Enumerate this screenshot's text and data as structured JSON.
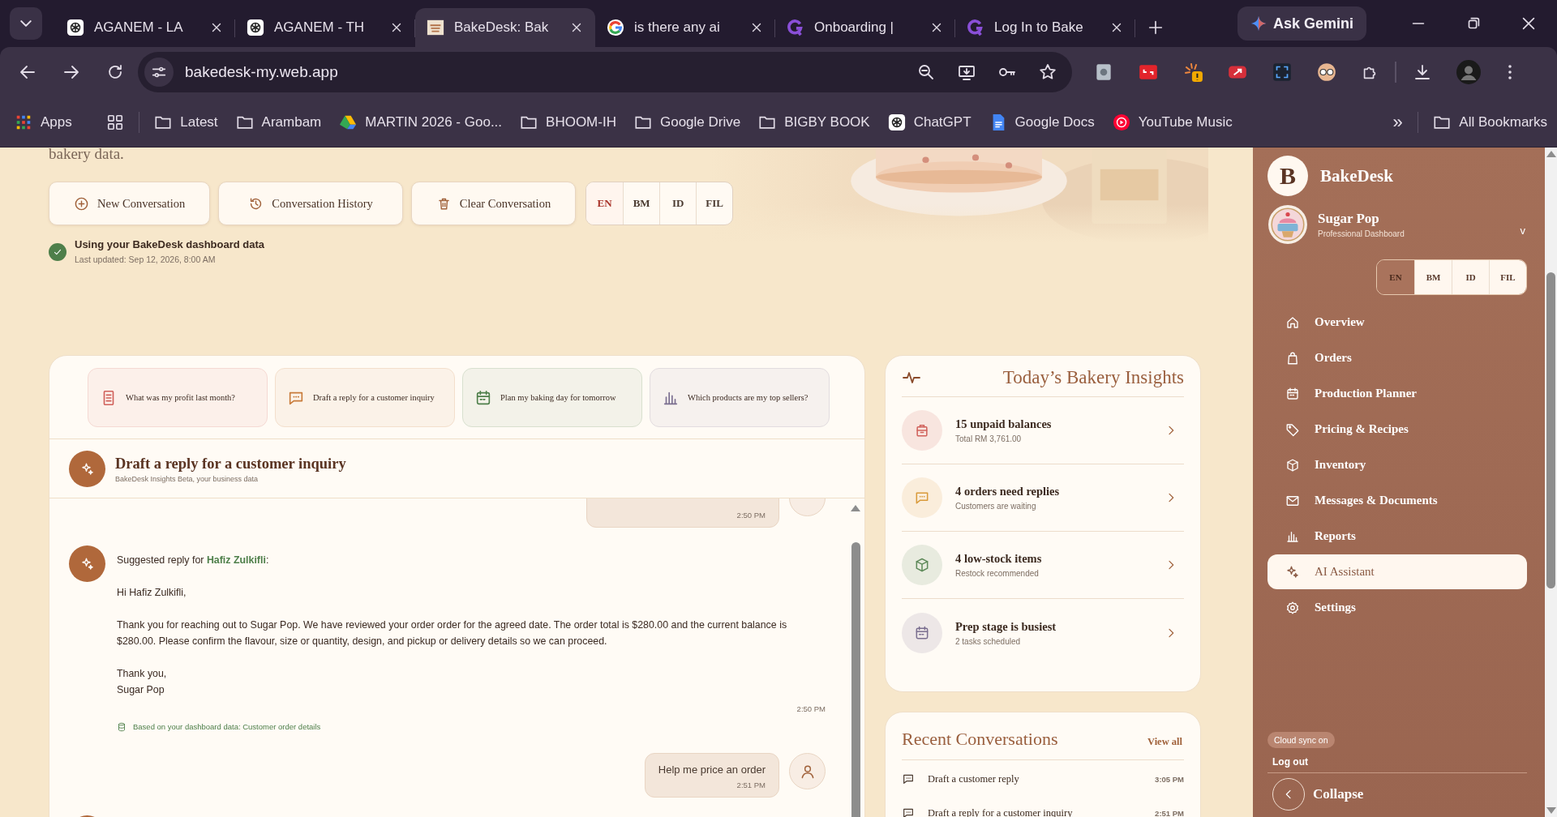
{
  "browser": {
    "tabs": [
      {
        "title": "AGANEM - LA",
        "kind": "knot",
        "selected": false
      },
      {
        "title": "AGANEM - TH",
        "kind": "knot",
        "selected": false
      },
      {
        "title": "BakeDesk: Bak",
        "kind": "bakery",
        "selected": true
      },
      {
        "title": "is there any ai",
        "kind": "google",
        "selected": false
      },
      {
        "title": "Onboarding |",
        "kind": "swirl",
        "selected": false
      },
      {
        "title": "Log In to Bake",
        "kind": "swirl",
        "selected": false
      }
    ],
    "assistant_button": "Ask Gemini",
    "url": "bakedesk-my.web.app",
    "bookmarks": [
      {
        "label": "Apps",
        "kind": "apps"
      },
      {
        "label": "Latest",
        "kind": "folder"
      },
      {
        "label": "Arambam",
        "kind": "folder"
      },
      {
        "label": "MARTIN 2026 - Goo...",
        "kind": "drive"
      },
      {
        "label": "BHOOM-IH",
        "kind": "folder"
      },
      {
        "label": "Google Drive",
        "kind": "folder"
      },
      {
        "label": "BIGBY BOOK",
        "kind": "folder"
      },
      {
        "label": "ChatGPT",
        "kind": "knot"
      },
      {
        "label": "Google Docs",
        "kind": "docs"
      },
      {
        "label": "YouTube Music",
        "kind": "ytmusic"
      }
    ],
    "overflow": "»",
    "all_bookmarks": "All Bookmarks"
  },
  "page": {
    "intro_tail": "bakery data.",
    "actions": [
      {
        "label": "New Conversation",
        "kind": "plus"
      },
      {
        "label": "Conversation History",
        "kind": "history"
      },
      {
        "label": "Clear Conversation",
        "kind": "trash"
      }
    ],
    "languages": [
      {
        "label": "EN",
        "selected": true
      },
      {
        "label": "BM",
        "selected": false
      },
      {
        "label": "ID",
        "selected": false
      },
      {
        "label": "FIL",
        "selected": false
      }
    ],
    "data_status": {
      "title": "Using your BakeDesk dashboard data",
      "updated": "Last updated: Sep 12, 2026, 8:00 AM"
    },
    "suggestions": [
      {
        "label": "What was my profit last month?",
        "kind": "doc",
        "color": "#d0605a"
      },
      {
        "label": "Draft a reply for a customer inquiry",
        "kind": "chat",
        "color": "#c87b3a"
      },
      {
        "label": "Plan my baking day for tomorrow",
        "kind": "calendar",
        "color": "#4e7f4a"
      },
      {
        "label": "Which products are my top sellers?",
        "kind": "chart",
        "color": "#7b6f90"
      }
    ],
    "chat": {
      "title": "Draft a reply for a customer inquiry",
      "subtitle": "BakeDesk Insights Beta, your business data",
      "messages": [
        {
          "kind": "user",
          "time": "2:50 PM"
        },
        {
          "kind": "assistant",
          "intro": "Suggested reply for **Hafiz Zulkifli**:",
          "paragraphs": [
            [
              "Hi Hafiz Zulkifli,"
            ],
            [
              "Thank you for reaching out to Sugar Pop. We have reviewed your order order for the agreed date. The order total is $280.00 and the current balance is $280.00. Please confirm the flavour, size or quantity, design, and pickup or delivery details so we can proceed."
            ],
            [
              "Thank you,",
              "Sugar Pop"
            ]
          ],
          "time": "2:50 PM",
          "source": "Based on your dashboard data: Customer order details"
        },
        {
          "kind": "user",
          "text": "Help me price an order",
          "time": "2:51 PM"
        },
        {
          "kind": "assistant"
        }
      ]
    },
    "insights": {
      "title": "Today’s Bakery Insights",
      "items": [
        {
          "title": "15 unpaid balances",
          "detail": "Total RM 3,761.00",
          "kind": "wallet",
          "color": "#d0605a"
        },
        {
          "title": "4 orders need replies",
          "detail": "Customers are waiting",
          "kind": "chat",
          "color": "#d99a3a"
        },
        {
          "title": "4 low-stock items",
          "detail": "Restock recommended",
          "kind": "box",
          "color": "#5e8a5a"
        },
        {
          "title": "Prep stage is busiest",
          "detail": "2 tasks scheduled",
          "kind": "calendar",
          "color": "#7b6f90"
        }
      ]
    },
    "recent": {
      "title": "Recent Conversations",
      "view_all": "View all",
      "items": [
        {
          "title": "Draft a customer reply",
          "time": "3:05 PM"
        },
        {
          "title": "Draft a reply for a customer inquiry",
          "time": "2:51 PM"
        }
      ]
    }
  },
  "sidebar": {
    "brand_initial": "B",
    "brand": "BakeDesk",
    "profile": {
      "name": "Sugar Pop",
      "role": "Professional Dashboard"
    },
    "menu_caret": "v",
    "languages": [
      {
        "label": "EN",
        "selected": true
      },
      {
        "label": "BM",
        "selected": false
      },
      {
        "label": "ID",
        "selected": false
      },
      {
        "label": "FIL",
        "selected": false
      }
    ],
    "nav": [
      {
        "label": "Overview",
        "kind": "home",
        "selected": false
      },
      {
        "label": "Orders",
        "kind": "bag",
        "selected": false
      },
      {
        "label": "Production Planner",
        "kind": "calendar",
        "selected": false
      },
      {
        "label": "Pricing & Recipes",
        "kind": "tag",
        "selected": false
      },
      {
        "label": "Inventory",
        "kind": "box",
        "selected": false
      },
      {
        "label": "Messages & Documents",
        "kind": "mail",
        "selected": false
      },
      {
        "label": "Reports",
        "kind": "chart",
        "selected": false
      },
      {
        "label": "AI Assistant",
        "kind": "sparkle",
        "selected": true
      },
      {
        "label": "Settings",
        "kind": "gear",
        "selected": false
      }
    ],
    "sync": "Cloud sync on",
    "logout": "Log out",
    "collapse": "Collapse"
  }
}
